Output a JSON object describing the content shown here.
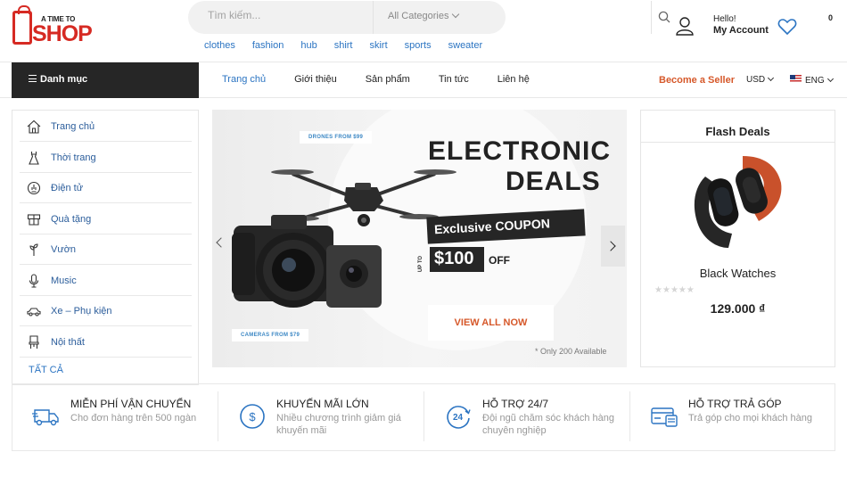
{
  "logo": {
    "tagline": "A TIME TO",
    "word": "SHOP"
  },
  "search": {
    "placeholder": "Tìm kiếm...",
    "category": "All Categories"
  },
  "tags": [
    "clothes",
    "fashion",
    "hub",
    "shirt",
    "skirt",
    "sports",
    "sweater"
  ],
  "account": {
    "hello": "Hello!",
    "label": "My Account",
    "cart_count": "0"
  },
  "nav": {
    "categories_label": "Danh mục",
    "menu": [
      {
        "label": "Trang chủ",
        "active": true
      },
      {
        "label": "Giới thiệu",
        "active": false
      },
      {
        "label": "Sản phẩm",
        "active": false
      },
      {
        "label": "Tin tức",
        "active": false
      },
      {
        "label": "Liên hệ",
        "active": false
      }
    ],
    "seller": "Become a Seller",
    "currency": "USD",
    "language": "ENG"
  },
  "sidebar": {
    "items": [
      {
        "label": "Trang chủ",
        "icon": "home-icon"
      },
      {
        "label": "Thời trang",
        "icon": "dress-icon"
      },
      {
        "label": "Điện tử",
        "icon": "electronics-icon"
      },
      {
        "label": "Quà tặng",
        "icon": "gift-icon"
      },
      {
        "label": "Vườn",
        "icon": "plant-icon"
      },
      {
        "label": "Music",
        "icon": "microphone-icon"
      },
      {
        "label": "Xe – Phụ kiện",
        "icon": "car-icon"
      },
      {
        "label": "Nội thất",
        "icon": "chair-icon"
      }
    ],
    "all_label": "TẤT CẢ"
  },
  "banner": {
    "drones_pill": "DRONES FROM $99",
    "cameras_pill": "CAMERAS FROM $79",
    "title_line1": "ELECTRONIC",
    "title_line2": "DEALS",
    "coupon": "Exclusive COUPON",
    "up_to": "UP TO",
    "price": "$100",
    "off": "OFF",
    "cta": "VIEW ALL NOW",
    "availability": "* Only 200 Available"
  },
  "flash_deals": {
    "title": "Flash Deals",
    "product_name": "Black Watches",
    "rating": 0,
    "price": "129.000 ₫"
  },
  "features": [
    {
      "title": "MIỄN PHÍ VẬN CHUYỂN",
      "subtitle": "Cho đơn hàng trên 500 ngàn",
      "icon": "truck-icon"
    },
    {
      "title": "KHUYẾN MÃI LỚN",
      "subtitle": "Nhiều chương trình giảm giá khuyến mãi",
      "icon": "dollar-coin-icon"
    },
    {
      "title": "HỖ TRỢ 24/7",
      "subtitle": "Đội ngũ chăm sóc khách hàng chuyên nghiệp",
      "icon": "support-24-icon"
    },
    {
      "title": "HỖ TRỢ TRẢ GÓP",
      "subtitle": "Trả góp cho mọi khách hàng",
      "icon": "credit-card-icon"
    }
  ],
  "colors": {
    "accent_blue": "#2b74c2",
    "brand_red": "#d62a23",
    "seller_orange": "#d6582a",
    "dark": "#262626"
  }
}
